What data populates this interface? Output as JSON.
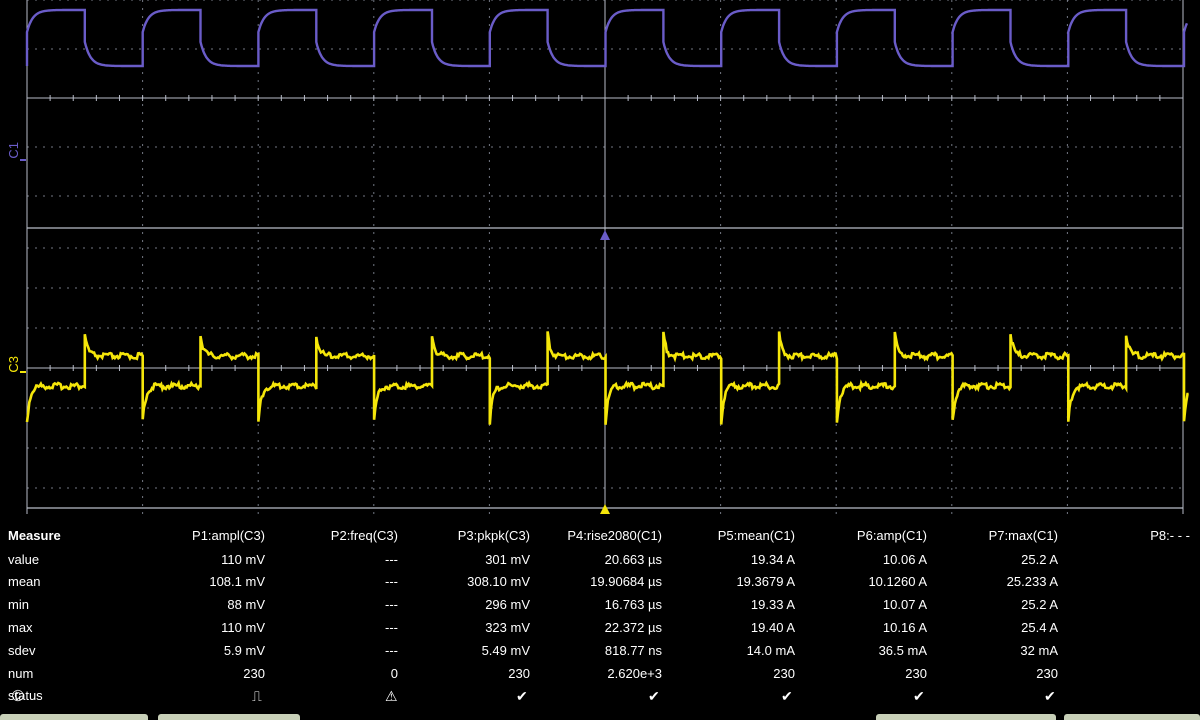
{
  "channels": {
    "c1": {
      "label": "C1",
      "color": "#6a5cc8"
    },
    "c3": {
      "label": "C3",
      "color": "#f5e60a"
    }
  },
  "measure": {
    "title": "Measure",
    "row_labels": [
      "value",
      "mean",
      "min",
      "max",
      "sdev",
      "num",
      "status"
    ],
    "columns": [
      {
        "header": "P1:ampl(C3)",
        "values": [
          "110 mV",
          "108.1 mV",
          "88 mV",
          "110 mV",
          "5.9 mV",
          "230"
        ],
        "status": "pulse-icon"
      },
      {
        "header": "P2:freq(C3)",
        "values": [
          "---",
          "---",
          "---",
          "---",
          "---",
          "0"
        ],
        "status": "warning-icon"
      },
      {
        "header": "P3:pkpk(C3)",
        "values": [
          "301 mV",
          "308.10 mV",
          "296 mV",
          "323 mV",
          "5.49 mV",
          "230"
        ],
        "status": "check-icon"
      },
      {
        "header": "P4:rise2080(C1)",
        "values": [
          "20.663 µs",
          "19.90684 µs",
          "16.763 µs",
          "22.372 µs",
          "818.77 ns",
          "2.620e+3"
        ],
        "status": "check-icon"
      },
      {
        "header": "P5:mean(C1)",
        "values": [
          "19.34 A",
          "19.3679 A",
          "19.33 A",
          "19.40 A",
          "14.0 mA",
          "230"
        ],
        "status": "check-icon"
      },
      {
        "header": "P6:amp(C1)",
        "values": [
          "10.06 A",
          "10.1260 A",
          "10.07 A",
          "10.16 A",
          "36.5 mA",
          "230"
        ],
        "status": "check-icon"
      },
      {
        "header": "P7:max(C1)",
        "values": [
          "25.2 A",
          "25.233 A",
          "25.2 A",
          "25.4 A",
          "32 mA",
          "230"
        ],
        "status": "check-icon"
      },
      {
        "header": "P8:- - -",
        "values": [
          "",
          "",
          "",
          "",
          "",
          ""
        ],
        "status": ""
      }
    ]
  },
  "watermark": "©"
}
